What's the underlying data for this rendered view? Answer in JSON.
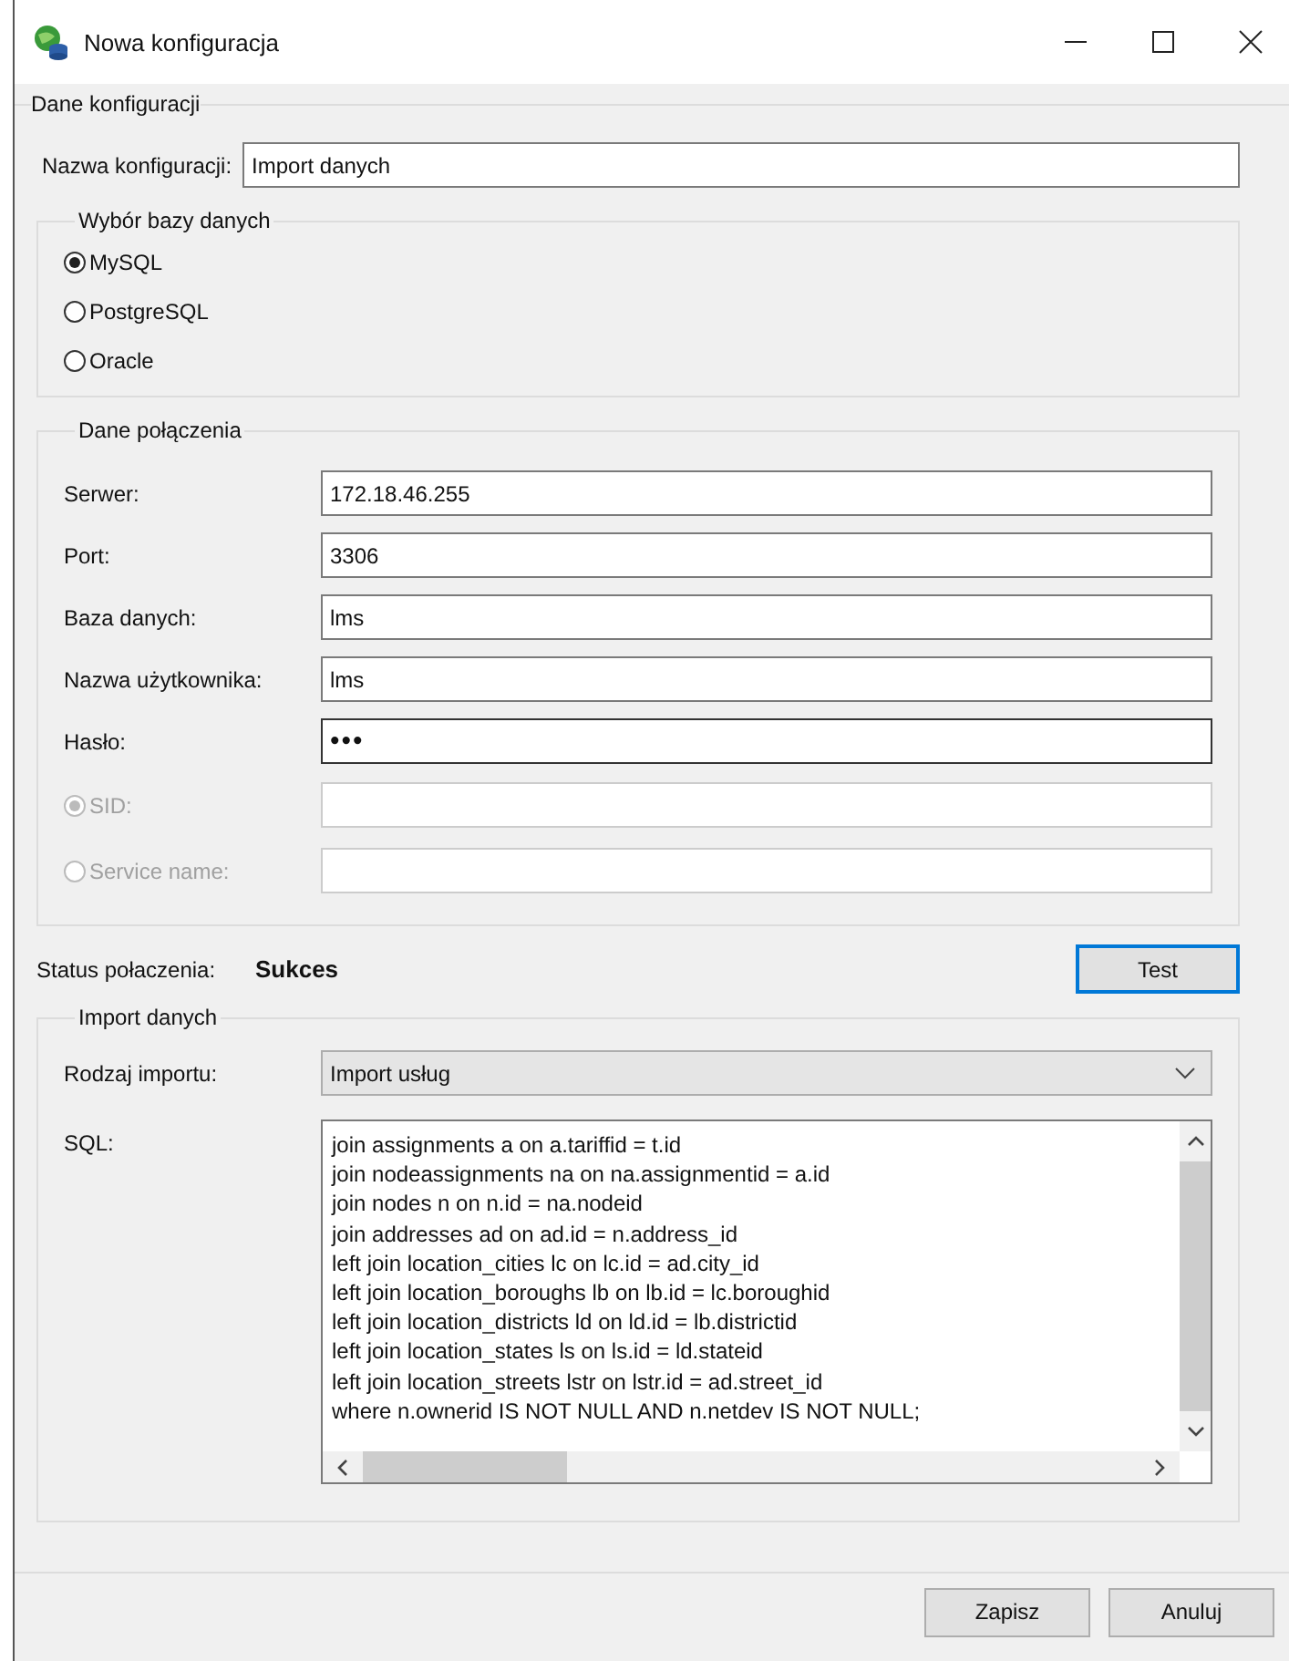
{
  "window": {
    "title": "Nowa konfiguracja"
  },
  "config": {
    "title": "Dane konfiguracji",
    "name_label": "Nazwa konfiguracji:",
    "name_value": "Import danych"
  },
  "database": {
    "title": "Wybór bazy danych",
    "options": [
      {
        "label": "MySQL",
        "selected": true
      },
      {
        "label": "PostgreSQL",
        "selected": false
      },
      {
        "label": "Oracle",
        "selected": false
      }
    ]
  },
  "connection": {
    "title": "Dane połączenia",
    "fields": [
      {
        "kind": "text",
        "label": "Serwer:",
        "value": "172.18.46.255",
        "disabled": false
      },
      {
        "kind": "text",
        "label": "Port:",
        "value": "3306",
        "disabled": false
      },
      {
        "kind": "text",
        "label": "Baza danych:",
        "value": "lms",
        "disabled": false
      },
      {
        "kind": "text",
        "label": "Nazwa użytkownika:",
        "value": "lms",
        "disabled": false
      },
      {
        "kind": "password",
        "label": "Hasło:",
        "value": "•••",
        "disabled": false
      },
      {
        "kind": "radio",
        "label": "SID:",
        "disabled": true,
        "selected": true
      },
      {
        "kind": "radio",
        "label": "Service name:",
        "disabled": true,
        "selected": false
      }
    ]
  },
  "status": {
    "label": "Status połaczenia:",
    "value": "Sukces"
  },
  "test_button": "Test",
  "import": {
    "title": "Import danych",
    "type_label": "Rodzaj importu:",
    "type_value": "Import usług",
    "sql_label": "SQL:",
    "sql_lines": [
      "join assignments a on a.tariffid = t.id",
      "join nodeassignments na on na.assignmentid = a.id",
      "join nodes n on n.id = na.nodeid",
      "join addresses ad on ad.id = n.address_id",
      "left join location_cities lc on lc.id = ad.city_id",
      "left join location_boroughs lb on lb.id = lc.boroughid",
      "left join location_districts ld on ld.id = lb.districtid",
      "left join location_states ls on ls.id = ld.stateid",
      "left join location_streets lstr on lstr.id = ad.street_id",
      "where n.ownerid IS NOT NULL AND n.netdev IS NOT NULL;"
    ]
  },
  "buttons": [
    "Zapisz",
    "Anuluj"
  ]
}
